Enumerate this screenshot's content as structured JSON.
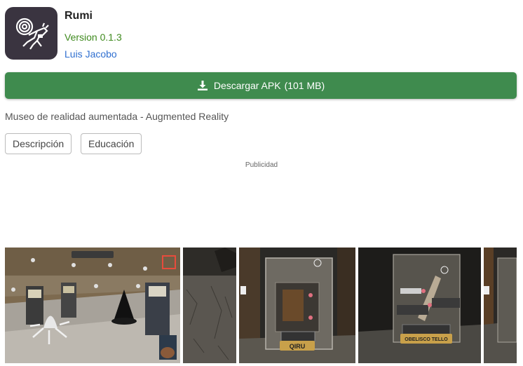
{
  "app": {
    "title": "Rumi",
    "version": "Version 0.1.3",
    "author": "Luis Jacobo",
    "icon": "spiral-llama-icon"
  },
  "download": {
    "label": "Descargar APK",
    "size": "(101 MB)",
    "icon": "download-icon"
  },
  "tagline": "Museo de realidad aumentada - Augmented Reality",
  "tabs": [
    {
      "label": "Descripción"
    },
    {
      "label": "Educación"
    }
  ],
  "ad": {
    "label": "Publicidad"
  },
  "screenshots": {
    "captions": [
      "QIRU",
      "OBELISCO TELLO"
    ]
  },
  "colors": {
    "download_bg": "#3f8b4e",
    "version": "#3f8a1e",
    "author_link": "#2f6fd0",
    "icon_bg": "#3a3440"
  }
}
